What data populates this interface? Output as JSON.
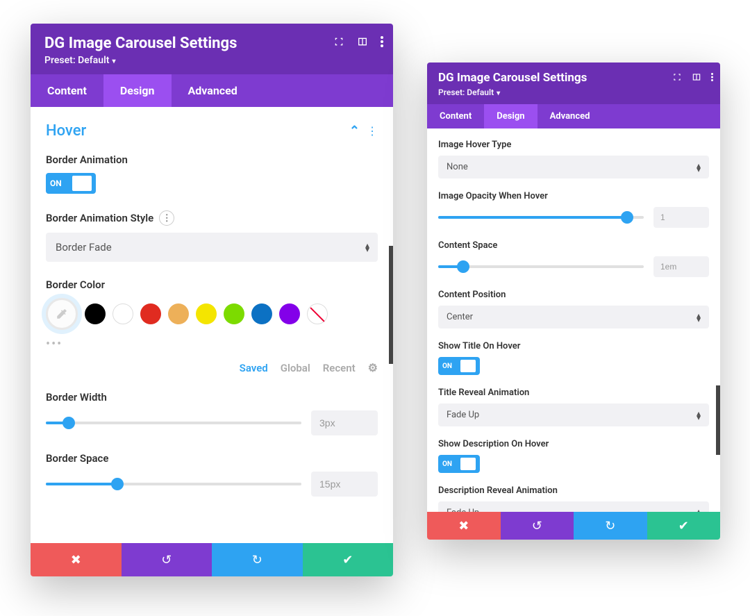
{
  "left": {
    "header": {
      "title": "DG Image Carousel Settings",
      "preset": "Preset: Default"
    },
    "tabs": {
      "content": "Content",
      "design": "Design",
      "advanced": "Advanced"
    },
    "section": {
      "title": "Hover"
    },
    "border_animation": {
      "label": "Border Animation",
      "value": "ON"
    },
    "border_animation_style": {
      "label": "Border Animation Style",
      "value": "Border Fade"
    },
    "border_color": {
      "label": "Border Color",
      "tabs": {
        "saved": "Saved",
        "global": "Global",
        "recent": "Recent"
      }
    },
    "border_width": {
      "label": "Border Width",
      "value": "3px",
      "percent": 9
    },
    "border_space": {
      "label": "Border Space",
      "value": "15px",
      "percent": 28
    }
  },
  "right": {
    "header": {
      "title": "DG Image Carousel Settings",
      "preset": "Preset: Default"
    },
    "tabs": {
      "content": "Content",
      "design": "Design",
      "advanced": "Advanced"
    },
    "image_hover_type": {
      "label": "Image Hover Type",
      "value": "None"
    },
    "image_opacity": {
      "label": "Image Opacity When Hover",
      "value": "1",
      "percent": 92
    },
    "content_space": {
      "label": "Content Space",
      "value": "1em",
      "percent": 12
    },
    "content_position": {
      "label": "Content Position",
      "value": "Center"
    },
    "show_title": {
      "label": "Show Title On Hover",
      "value": "ON"
    },
    "title_reveal": {
      "label": "Title Reveal Animation",
      "value": "Fade Up"
    },
    "show_description": {
      "label": "Show Description On Hover",
      "value": "ON"
    },
    "description_reveal": {
      "label": "Description Reveal Animation",
      "value": "Fade Up"
    }
  },
  "colors": [
    "#000000",
    "#ffffff",
    "#e02b20",
    "#edb059",
    "#f4e500",
    "#7cdb00",
    "#0c71c3",
    "#8300e9"
  ]
}
